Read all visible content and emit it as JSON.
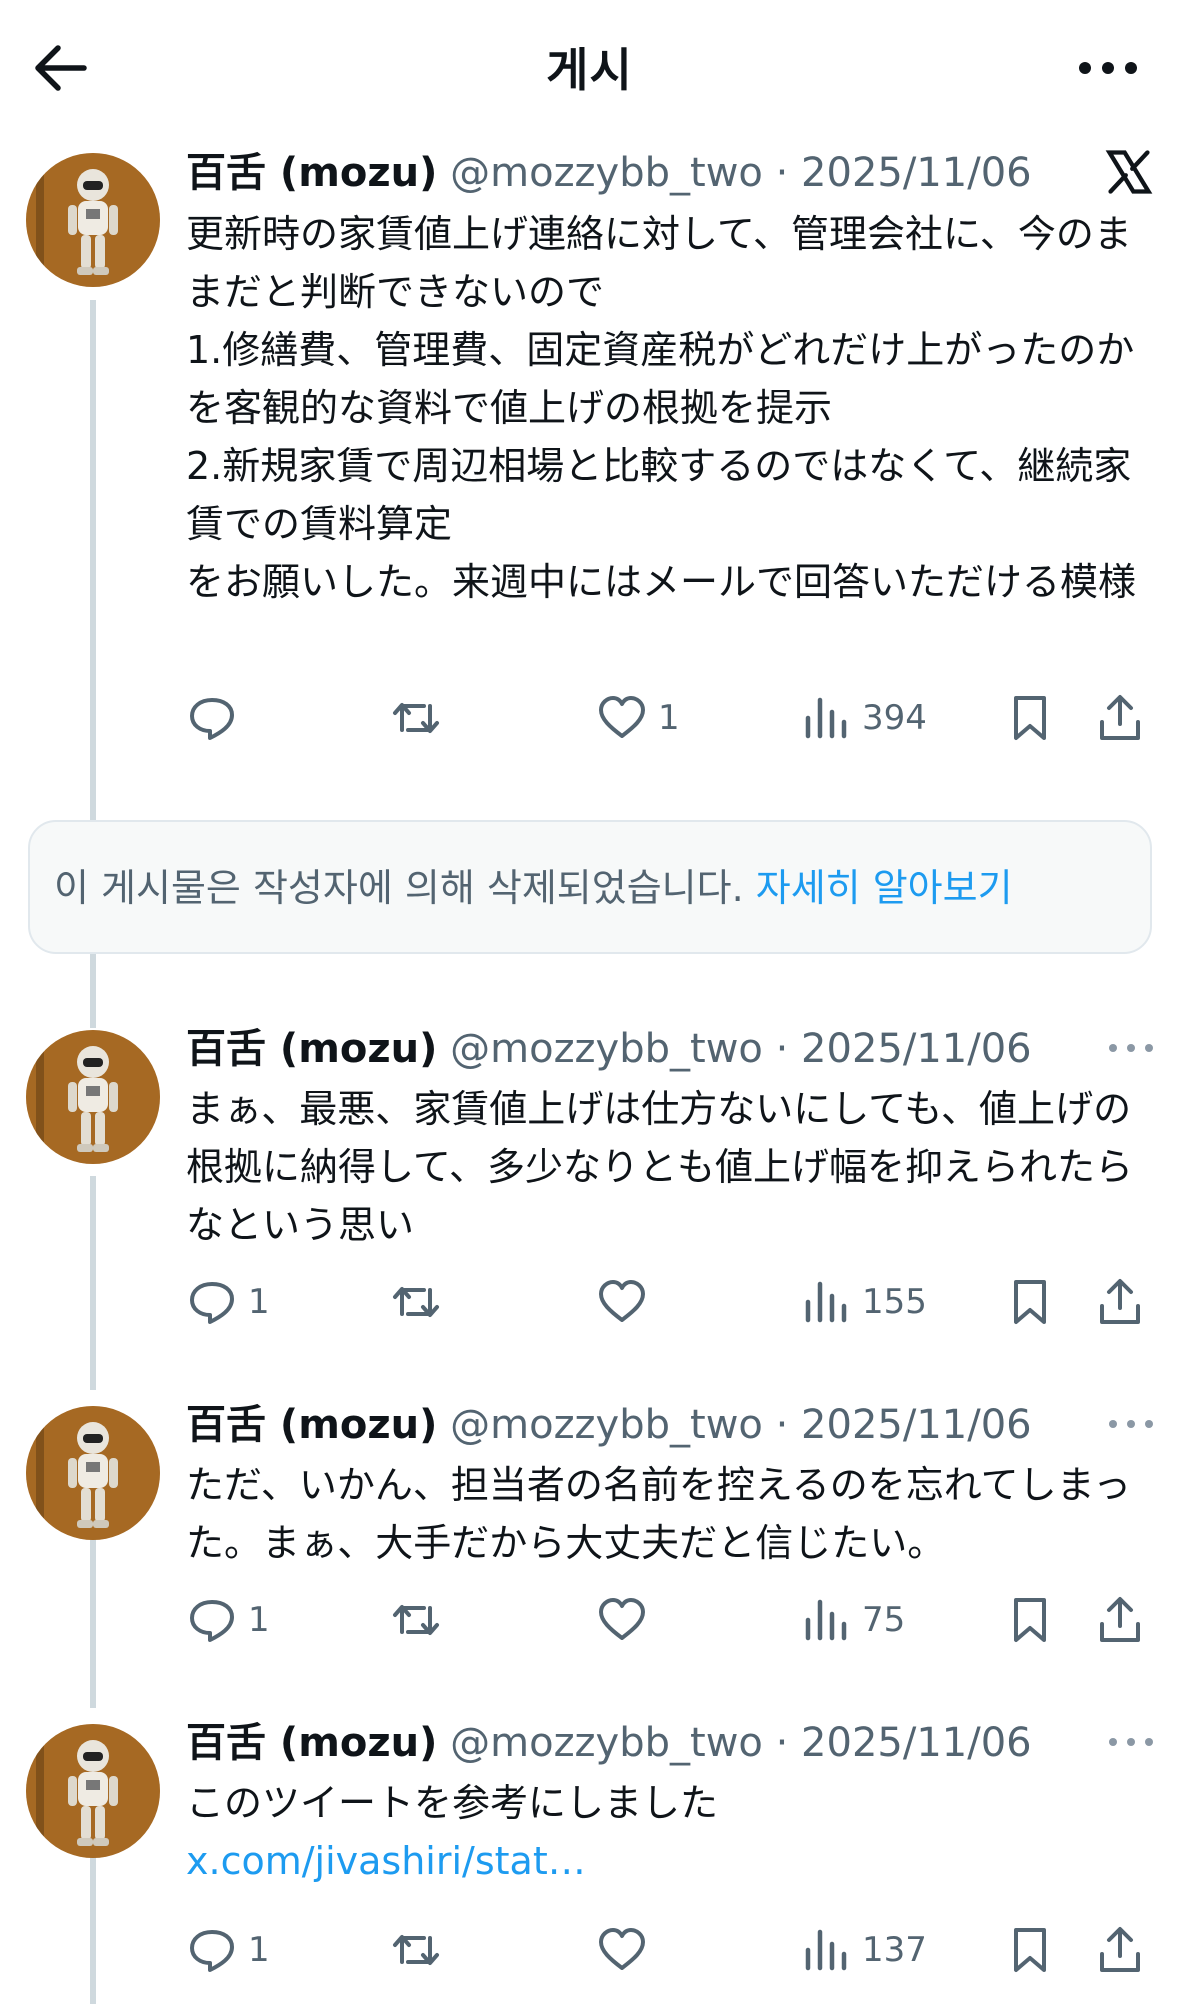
{
  "header": {
    "title": "게시"
  },
  "author": {
    "name": "百舌 (mozu)",
    "handle": "@mozzybb_two",
    "separator": " · ",
    "avatar_icon": "robot-avatar"
  },
  "tweets": [
    {
      "date": "2025/11/06",
      "text": "更新時の家賃値上げ連絡に対して、管理会社に、今のままだと判断できないので\n1.修繕費、管理費、固定資産税がどれだけ上がったのかを客観的な資料で値上げの根拠を提示\n2.新規家賃で周辺相場と比較するのではなくて、継続家賃での賃料算定\nをお願いした。来週中にはメールで回答いただける模様",
      "replies": "",
      "retweets": "",
      "likes": "1",
      "views": "394"
    },
    {
      "date": "2025/11/06",
      "text": "まぁ、最悪、家賃値上げは仕方ないにしても、値上げの根拠に納得して、多少なりとも値上げ幅を抑えられたらなという思い",
      "replies": "1",
      "retweets": "",
      "likes": "",
      "views": "155"
    },
    {
      "date": "2025/11/06",
      "text": "ただ、いかん、担当者の名前を控えるのを忘れてしまった。まぁ、大手だから大丈夫だと信じたい。",
      "replies": "1",
      "retweets": "",
      "likes": "",
      "views": "75"
    },
    {
      "date": "2025/11/06",
      "text": "このツイートを参考にしました",
      "link": "x.com/jivashiri/stat…",
      "replies": "1",
      "retweets": "",
      "likes": "",
      "views": "137"
    }
  ],
  "deleted_notice": {
    "text": "이 게시물은 작성자에 의해 삭제되었습니다. ",
    "learn_more": "자세히 알아보기"
  },
  "colors": {
    "link": "#1d9bf0",
    "secondary": "#536471",
    "thread_line": "#cfd9de"
  }
}
